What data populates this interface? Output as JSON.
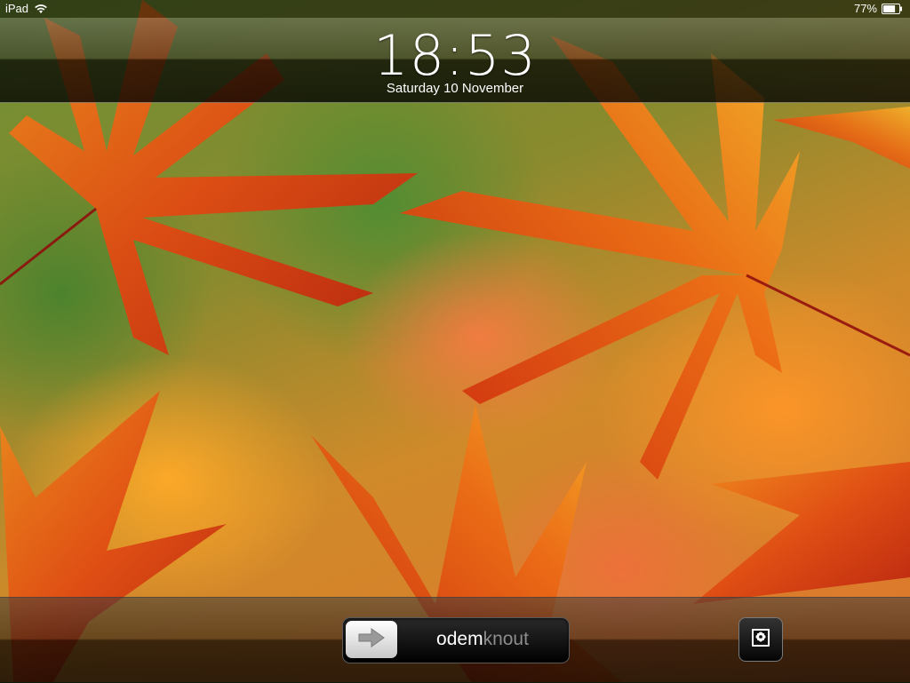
{
  "status_bar": {
    "device": "iPad",
    "battery_percent": "77%",
    "battery_level": 0.77
  },
  "lock_screen": {
    "time": "18:53",
    "date": "Saturday 10 November"
  },
  "unlock_slider": {
    "label_highlight": "odem",
    "label_rest": "knout",
    "knob_icon": "arrow-right-icon"
  },
  "photo_frame_button": {
    "icon": "photo-frame-flower-icon"
  },
  "colors": {
    "bar_dark": "#000000",
    "text": "#ffffff",
    "slider_text_dim": "#8c8c8c"
  }
}
